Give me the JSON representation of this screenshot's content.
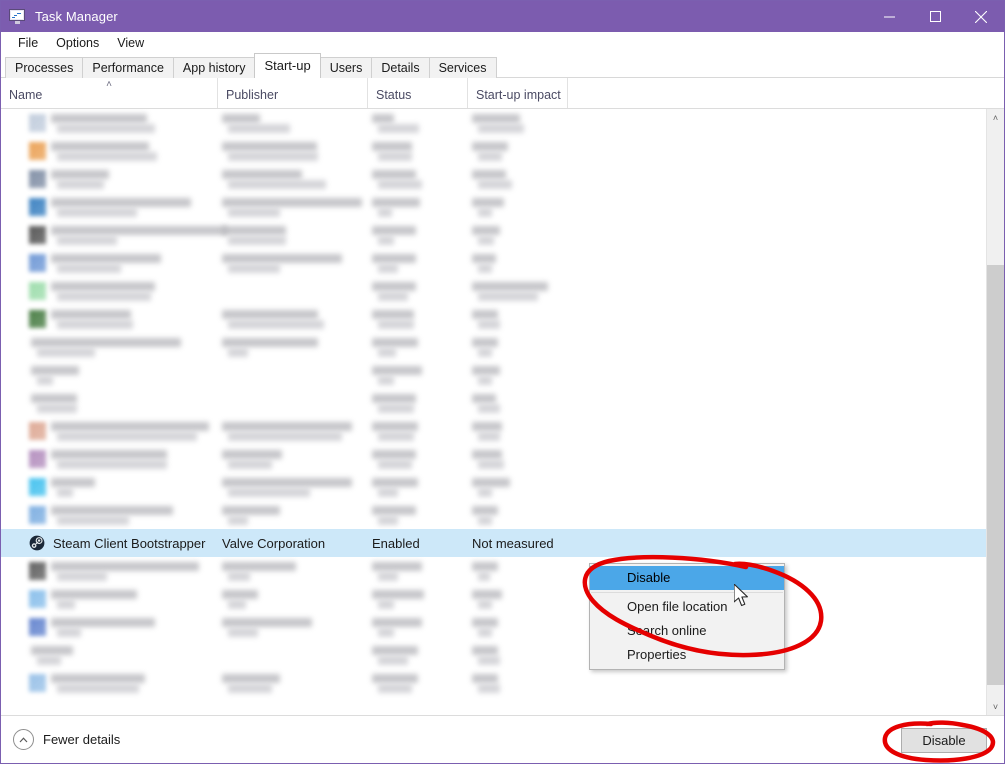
{
  "window": {
    "title": "Task Manager",
    "icon": "task-manager-icon",
    "controls": {
      "minimize": "─",
      "maximize": "□",
      "close": "✕"
    },
    "titlebar_color": "#7c5caf"
  },
  "menu": {
    "items": [
      "File",
      "Options",
      "View"
    ]
  },
  "tabs": {
    "active": "Start-up",
    "items": [
      "Processes",
      "Performance",
      "App history",
      "Start-up",
      "Users",
      "Details",
      "Services"
    ]
  },
  "columns": [
    {
      "label": "Name",
      "sort": "˄"
    },
    {
      "label": "Publisher",
      "sort": ""
    },
    {
      "label": "Status",
      "sort": ""
    },
    {
      "label": "Start-up impact",
      "sort": ""
    }
  ],
  "rows": [
    {
      "name": "",
      "publisher": "",
      "status": "",
      "impact": "",
      "redacted": true,
      "icon_color": "#b9c6d8",
      "name_w": [
        96,
        98
      ],
      "pub_w": [
        38,
        62
      ],
      "stat_w": [
        22,
        41
      ],
      "imp_w": [
        48,
        46
      ]
    },
    {
      "name": "",
      "publisher": "",
      "status": "",
      "impact": "",
      "redacted": true,
      "icon_color": "#e8953f",
      "name_w": [
        98,
        100
      ],
      "pub_w": [
        95,
        90
      ],
      "stat_w": [
        40,
        34
      ],
      "imp_w": [
        36,
        24
      ]
    },
    {
      "name": "",
      "publisher": "",
      "status": "",
      "impact": "",
      "redacted": true,
      "icon_color": "#6f7f99",
      "name_w": [
        58,
        47
      ],
      "pub_w": [
        80,
        98
      ],
      "stat_w": [
        44,
        44
      ],
      "imp_w": [
        34,
        34
      ]
    },
    {
      "name": "",
      "publisher": "",
      "status": "",
      "impact": "",
      "redacted": true,
      "icon_color": "#1f6fb8",
      "name_w": [
        140,
        80
      ],
      "pub_w": [
        140,
        52
      ],
      "stat_w": [
        48,
        14
      ],
      "imp_w": [
        32,
        14
      ]
    },
    {
      "name": "",
      "publisher": "",
      "status": "",
      "impact": "",
      "redacted": true,
      "icon_color": "#3d3d3d",
      "name_w": [
        176,
        60
      ],
      "pub_w": [
        64,
        58
      ],
      "stat_w": [
        44,
        16
      ],
      "imp_w": [
        28,
        16
      ]
    },
    {
      "name": "",
      "publisher": "",
      "status": "",
      "impact": "",
      "redacted": true,
      "icon_color": "#5b8ad0",
      "name_w": [
        110,
        64
      ],
      "pub_w": [
        120,
        52
      ],
      "stat_w": [
        44,
        20
      ],
      "imp_w": [
        24,
        14
      ]
    },
    {
      "name": "",
      "publisher": "",
      "status": "",
      "impact": "",
      "redacted": true,
      "icon_color": "#8fd8a0",
      "name_w": [
        104,
        94
      ],
      "pub_w": [
        0,
        0
      ],
      "stat_w": [
        44,
        30
      ],
      "imp_w": [
        76,
        60
      ]
    },
    {
      "name": "",
      "publisher": "",
      "status": "",
      "impact": "",
      "redacted": true,
      "icon_color": "#2f6b2a",
      "name_w": [
        80,
        76
      ],
      "pub_w": [
        96,
        96
      ],
      "stat_w": [
        42,
        36
      ],
      "imp_w": [
        26,
        22
      ]
    },
    {
      "name": "",
      "publisher": "",
      "status": "",
      "impact": "",
      "redacted": true,
      "icon_color": "",
      "name_w": [
        150,
        58
      ],
      "pub_w": [
        96,
        20
      ],
      "stat_w": [
        46,
        18
      ],
      "imp_w": [
        26,
        14
      ]
    },
    {
      "name": "",
      "publisher": "",
      "status": "",
      "impact": "",
      "redacted": true,
      "icon_color": "",
      "name_w": [
        48,
        16
      ],
      "pub_w": [
        0,
        0
      ],
      "stat_w": [
        50,
        16
      ],
      "imp_w": [
        28,
        14
      ]
    },
    {
      "name": "",
      "publisher": "",
      "status": "",
      "impact": "",
      "redacted": true,
      "icon_color": "",
      "name_w": [
        46,
        40
      ],
      "pub_w": [
        0,
        0
      ],
      "stat_w": [
        44,
        36
      ],
      "imp_w": [
        24,
        22
      ]
    },
    {
      "name": "",
      "publisher": "",
      "status": "",
      "impact": "",
      "redacted": true,
      "icon_color": "#d99d86",
      "name_w": [
        158,
        140
      ],
      "pub_w": [
        130,
        114
      ],
      "stat_w": [
        46,
        36
      ],
      "imp_w": [
        30,
        22
      ]
    },
    {
      "name": "",
      "publisher": "",
      "status": "",
      "impact": "",
      "redacted": true,
      "icon_color": "#a97fb5",
      "name_w": [
        116,
        110
      ],
      "pub_w": [
        60,
        44
      ],
      "stat_w": [
        44,
        34
      ],
      "imp_w": [
        30,
        26
      ]
    },
    {
      "name": "",
      "publisher": "",
      "status": "",
      "impact": "",
      "redacted": true,
      "icon_color": "#2bb9ec",
      "name_w": [
        44,
        16
      ],
      "pub_w": [
        130,
        82
      ],
      "stat_w": [
        46,
        20
      ],
      "imp_w": [
        38,
        14
      ]
    },
    {
      "name": "",
      "publisher": "",
      "status": "",
      "impact": "",
      "redacted": true,
      "icon_color": "#6ba3dd",
      "name_w": [
        122,
        72
      ],
      "pub_w": [
        58,
        20
      ],
      "stat_w": [
        44,
        20
      ],
      "imp_w": [
        26,
        14
      ]
    },
    {
      "name": "Steam Client Bootstrapper",
      "publisher": "Valve Corporation",
      "status": "Enabled",
      "impact": "Not measured",
      "redacted": false,
      "icon_color": "#1b2838",
      "selected": true
    },
    {
      "name": "",
      "publisher": "",
      "status": "",
      "impact": "",
      "redacted": true,
      "icon_color": "#4a4a4a",
      "name_w": [
        148,
        50
      ],
      "pub_w": [
        74,
        22
      ],
      "stat_w": [
        50,
        20
      ],
      "imp_w": [
        26,
        12
      ]
    },
    {
      "name": "",
      "publisher": "",
      "status": "",
      "impact": "",
      "redacted": true,
      "icon_color": "#79b6e8",
      "name_w": [
        86,
        18
      ],
      "pub_w": [
        36,
        18
      ],
      "stat_w": [
        52,
        16
      ],
      "imp_w": [
        30,
        14
      ]
    },
    {
      "name": "",
      "publisher": "",
      "status": "",
      "impact": "",
      "redacted": true,
      "icon_color": "#4f74c8",
      "name_w": [
        104,
        24
      ],
      "pub_w": [
        90,
        30
      ],
      "stat_w": [
        50,
        16
      ],
      "imp_w": [
        26,
        14
      ]
    },
    {
      "name": "",
      "publisher": "",
      "status": "",
      "impact": "",
      "redacted": true,
      "icon_color": "",
      "name_w": [
        42,
        24
      ],
      "pub_w": [
        0,
        0
      ],
      "stat_w": [
        46,
        30
      ],
      "imp_w": [
        26,
        22
      ]
    },
    {
      "name": "",
      "publisher": "",
      "status": "",
      "impact": "",
      "redacted": true,
      "icon_color": "#8ab8e4",
      "name_w": [
        94,
        82
      ],
      "pub_w": [
        58,
        44
      ],
      "stat_w": [
        46,
        34
      ],
      "imp_w": [
        26,
        22
      ]
    }
  ],
  "context_menu": {
    "items": [
      {
        "label": "Disable",
        "highlighted": true
      },
      {
        "label": "Open file location",
        "highlighted": false
      },
      {
        "label": "Search online",
        "highlighted": false
      },
      {
        "label": "Properties",
        "highlighted": false
      }
    ]
  },
  "footer": {
    "fewer_details": "Fewer details",
    "fewer_icon": "chevron-up-icon",
    "disable_button": "Disable"
  },
  "scrollbar": {
    "up": "˄",
    "down": "˅"
  },
  "annotations": {
    "color": "#e50000",
    "shapes": [
      "circle-context-menu",
      "circle-disable-button"
    ]
  }
}
